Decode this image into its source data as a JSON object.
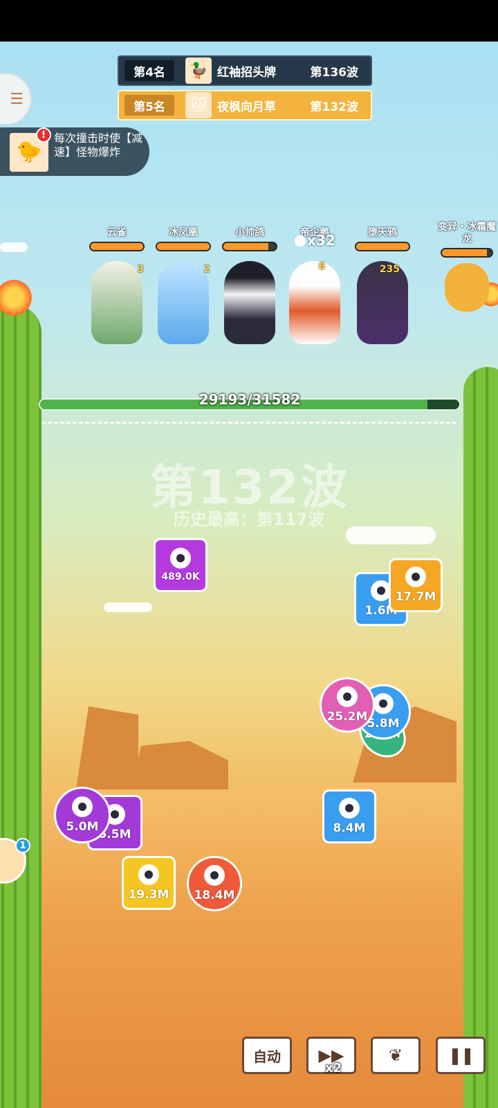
{
  "leaderboard": [
    {
      "rank": "第4名",
      "name": "红袖招头牌",
      "wave": "第136波",
      "avatar_icon": "duck-avatar-icon"
    },
    {
      "rank": "第5名",
      "name": "夜枫向月草",
      "wave": "第132波",
      "avatar_icon": "cat-avatar-icon"
    }
  ],
  "tip": {
    "text": "每次撞击时使【减速】怪物爆炸",
    "alert": "!"
  },
  "heroes": [
    {
      "name": "云雀",
      "level": "3",
      "hp_fraction": 1.0
    },
    {
      "name": "冰凤凰",
      "level": "2",
      "hp_fraction": 1.0
    },
    {
      "name": "小帅鸽",
      "level": "",
      "hp_fraction": 0.85
    },
    {
      "name": "帝企鹅",
      "level": "6",
      "hp_fraction": 0
    },
    {
      "name": "堕天鸦",
      "level": "235",
      "hp_fraction": 1.0
    }
  ],
  "ammo": {
    "count": "x32"
  },
  "boss": {
    "name": "变异・冰霜魔龙",
    "hp_fraction": 0.9
  },
  "base_hp": {
    "text": "29193/31582",
    "current": 29193,
    "max": 31582
  },
  "wave": {
    "title": "第132波",
    "best": "历史最高：第117波"
  },
  "monsters": [
    {
      "value": "489.0K",
      "color": "#b43ae0",
      "shape": "square"
    },
    {
      "value": "1.6M",
      "color": "#3a9ef0",
      "shape": "square"
    },
    {
      "value": "17.7M",
      "color": "#f5a623",
      "shape": "square"
    },
    {
      "value": "25.2M",
      "color": "#e35fb5",
      "shape": "round"
    },
    {
      "value": "5.8M",
      "color": "#3a9ef0",
      "shape": "round"
    },
    {
      "value": "20.6M",
      "color": "#36b37e",
      "shape": "diamond"
    },
    {
      "value": "5.0M",
      "color": "#a23ad8",
      "shape": "round"
    },
    {
      "value": "5.5M",
      "color": "#a23ad8",
      "shape": "square"
    },
    {
      "value": "8.4M",
      "color": "#3a9ef0",
      "shape": "square"
    },
    {
      "value": "19.3M",
      "color": "#f5c623",
      "shape": "square"
    },
    {
      "value": "18.4M",
      "color": "#ee5a3a",
      "shape": "round"
    }
  ],
  "controls": {
    "auto": "自动",
    "speed": "x2",
    "pet_badge": "1"
  },
  "colors": {
    "accent_orange": "#f3b33c",
    "health_green": "#4fb34a",
    "dark_panel": "#26394a"
  }
}
